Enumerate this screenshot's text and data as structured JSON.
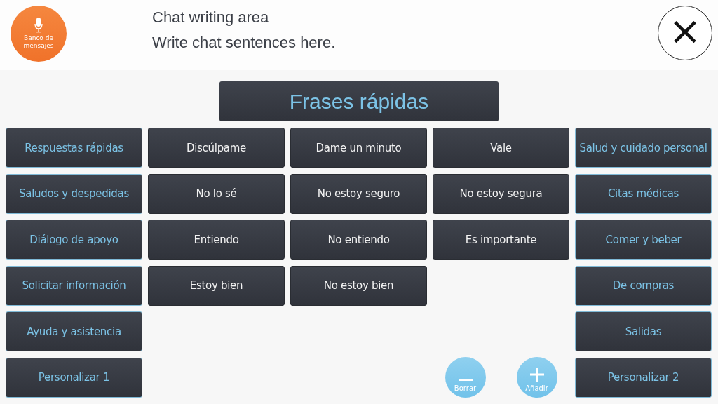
{
  "message_bank_button": {
    "label": "Banco de mensajes"
  },
  "chat_area": {
    "title": "Chat writing area",
    "placeholder": "Write chat sentences here."
  },
  "close_button": {
    "label": "×"
  },
  "section_title": "Frases rápidas",
  "left_categories": [
    "Respuestas rápidas",
    "Saludos y despedidas",
    "Diálogo de apoyo",
    "Solicitar información",
    "Ayuda y asistencia",
    "Personalizar 1"
  ],
  "phrase_rows": [
    [
      "Discúlpame",
      "Dame un minuto",
      "Vale"
    ],
    [
      "No lo sé",
      "No estoy seguro",
      "No estoy segura"
    ],
    [
      "Entiendo",
      "No entiendo",
      "Es importante"
    ],
    [
      "Estoy bien",
      "No estoy bien"
    ]
  ],
  "right_categories": [
    "Salud y cuidado personal",
    "Citas médicas",
    "Comer y beber",
    "De compras",
    "Salidas",
    "Personalizar 2"
  ],
  "actions": [
    {
      "kind": "remove",
      "label": "Borrar"
    },
    {
      "kind": "add",
      "label": "Añadir"
    }
  ]
}
